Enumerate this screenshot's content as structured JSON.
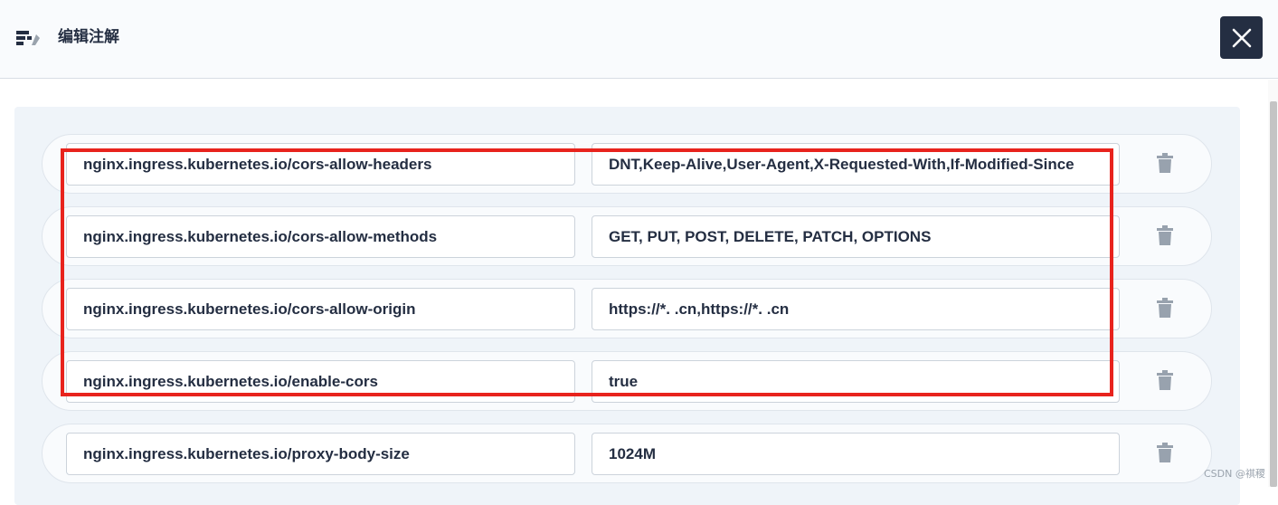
{
  "dialog": {
    "title": "编辑注解",
    "title_icon": "annotation-icon",
    "close_icon": "close-icon"
  },
  "annotations": [
    {
      "key": "nginx.ingress.kubernetes.io/cors-allow-headers",
      "value": "DNT,Keep-Alive,User-Agent,X-Requested-With,If-Modified-Since"
    },
    {
      "key": "nginx.ingress.kubernetes.io/cors-allow-methods",
      "value": "GET, PUT, POST, DELETE, PATCH, OPTIONS"
    },
    {
      "key": "nginx.ingress.kubernetes.io/cors-allow-origin",
      "value": "https://*.   .cn,https://*.   .cn"
    },
    {
      "key": "nginx.ingress.kubernetes.io/enable-cors",
      "value": "true"
    },
    {
      "key": "nginx.ingress.kubernetes.io/proxy-body-size",
      "value": "1024M"
    }
  ],
  "delete_icon": "trash-icon",
  "watermark": "CSDN @祺稷",
  "colors": {
    "highlight": "#e8231d",
    "close_button": "#242e42",
    "panel": "#eff4f9"
  }
}
